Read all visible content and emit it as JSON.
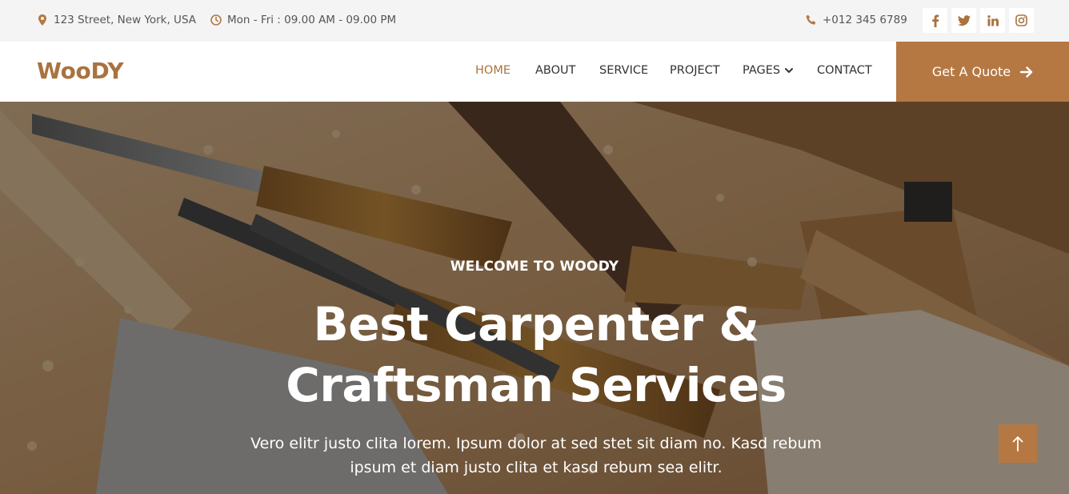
{
  "topbar": {
    "address": "123 Street, New York, USA",
    "hours": "Mon - Fri : 09.00 AM - 09.00 PM",
    "phone": "+012 345 6789",
    "social": [
      {
        "name": "facebook-icon"
      },
      {
        "name": "twitter-icon"
      },
      {
        "name": "linkedin-icon"
      },
      {
        "name": "instagram-icon"
      }
    ]
  },
  "nav": {
    "brand": "WooDY",
    "links": [
      "HOME",
      "ABOUT",
      "SERVICE",
      "PROJECT",
      "PAGES",
      "CONTACT"
    ],
    "active": "HOME",
    "cta": "Get A Quote"
  },
  "hero": {
    "eyebrow": "WELCOME TO WOODY",
    "headline_line1": "Best Carpenter &",
    "headline_line2": "Craftsman Services",
    "lead_line1": "Vero elitr justo clita lorem. Ipsum dolor at sed stet sit diam no. Kasd rebum",
    "lead_line2": "ipsum et diam justo clita et kasd rebum sea elitr."
  },
  "colors": {
    "accent": "#b57843",
    "brand": "#a9733f",
    "topbar_bg": "#f4f4f4"
  }
}
